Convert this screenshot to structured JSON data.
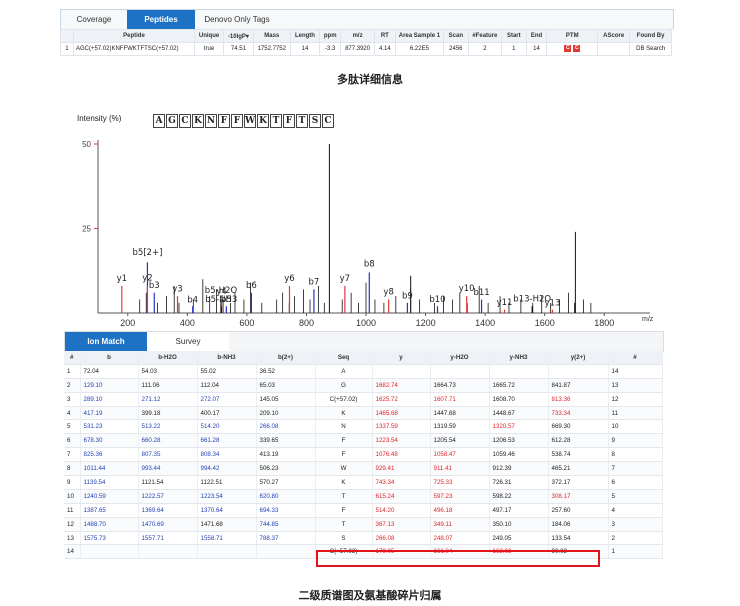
{
  "top_tabs": [
    "Coverage",
    "Peptides",
    "Denovo Only Tags"
  ],
  "peptide_table": {
    "headers": [
      "",
      "Peptide",
      "Unique",
      "-10lgP▾",
      "Mass",
      "Length",
      "ppm",
      "m/z",
      "RT",
      "Area Sample 1",
      "Scan",
      "#Feature",
      "Start",
      "End",
      "PTM",
      "AScore",
      "Found By"
    ],
    "row": [
      "1",
      "AGC(+57.02)KNFFWKTFTSC(+57.02)",
      "true",
      "74.51",
      "1752.7752",
      "14",
      "-3.3",
      "877.3920",
      "4.14",
      "6.22E5",
      "2456",
      "2",
      "1",
      "14",
      "",
      "",
      "DB Search"
    ],
    "ptm": [
      "C",
      "C"
    ]
  },
  "caption1": "多肽详细信息",
  "spectrum": {
    "y_label": "Intensity (%)",
    "x_label": "m/z",
    "sequence": [
      "A",
      "G",
      "C",
      "K",
      "N",
      "F",
      "F",
      "W",
      "K",
      "T",
      "F",
      "T",
      "S",
      "C"
    ],
    "x_ticks": [
      "200",
      "400",
      "600",
      "800",
      "1000",
      "1200",
      "1400",
      "1600",
      "1800"
    ],
    "y_ticks": [
      "50",
      "25"
    ],
    "xlim": [
      100,
      1920
    ],
    "ylim": [
      0,
      50
    ],
    "ion_labels": [
      "y1",
      "b5[2+]",
      "y2",
      "b3",
      "y3",
      "b4",
      "b5-H2O",
      "y4",
      "b5-NH3",
      "b5",
      "b6",
      "y6",
      "b7",
      "y7",
      "b8",
      "y8",
      "b9",
      "b10",
      "y10",
      "y11",
      "b11",
      "b13-H2O",
      "y13"
    ],
    "colors": {
      "b": "#2233cc",
      "y": "#e53935",
      "other": "#111111"
    }
  },
  "ion_tabs": [
    "Ion Match",
    "Survey"
  ],
  "ion_table": {
    "headers": [
      "#",
      "b",
      "b-H2O",
      "b-NH3",
      "b(2+)",
      "Seq",
      "y",
      "y-H2O",
      "y-NH3",
      "y(2+)",
      "#"
    ],
    "rows": [
      [
        "1",
        "72.04",
        "54.03",
        "55.02",
        "36.52",
        "A",
        "",
        "",
        "",
        "",
        "14"
      ],
      [
        "2",
        "129.10",
        "111.06",
        "112.04",
        "65.03",
        "G",
        "1682.74",
        "1664.73",
        "1665.72",
        "841.87",
        "13"
      ],
      [
        "3",
        "289.10",
        "271.12",
        "272.07",
        "145.05",
        "C(+57.02)",
        "1625.72",
        "1607.71",
        "1608.70",
        "813.36",
        "12"
      ],
      [
        "4",
        "417.19",
        "399.18",
        "400.17",
        "209.10",
        "K",
        "1465.68",
        "1447.68",
        "1448.67",
        "733.34",
        "11"
      ],
      [
        "5",
        "531.23",
        "513.22",
        "514.20",
        "266.08",
        "N",
        "1337.59",
        "1319.59",
        "1320.57",
        "669.30",
        "10"
      ],
      [
        "6",
        "678.30",
        "660.28",
        "661.28",
        "339.65",
        "F",
        "1223.54",
        "1205.54",
        "1206.53",
        "612.28",
        "9"
      ],
      [
        "7",
        "825.36",
        "807.35",
        "808.34",
        "413.19",
        "F",
        "1076.48",
        "1058.47",
        "1059.46",
        "538.74",
        "8"
      ],
      [
        "8",
        "1011.44",
        "993.44",
        "994.42",
        "506.23",
        "W",
        "929.41",
        "911.41",
        "912.39",
        "465.21",
        "7"
      ],
      [
        "9",
        "1139.54",
        "1121.54",
        "1122.51",
        "570.27",
        "K",
        "743.34",
        "725.33",
        "726.31",
        "372.17",
        "6"
      ],
      [
        "10",
        "1240.59",
        "1222.57",
        "1223.54",
        "620.80",
        "T",
        "615.24",
        "597.23",
        "598.22",
        "308.17",
        "5"
      ],
      [
        "11",
        "1387.65",
        "1369.64",
        "1370.64",
        "694.33",
        "F",
        "514.20",
        "496.18",
        "497.17",
        "257.60",
        "4"
      ],
      [
        "12",
        "1488.70",
        "1470.69",
        "1471.68",
        "744.85",
        "T",
        "367.13",
        "349.11",
        "350.10",
        "184.06",
        "3"
      ],
      [
        "13",
        "1575.73",
        "1557.71",
        "1558.71",
        "788.37",
        "S",
        "266.08",
        "248.07",
        "249.05",
        "133.54",
        "2"
      ],
      [
        "14",
        "",
        "",
        "",
        "",
        "C(+57.02)",
        "179.05",
        "161.04",
        "162.02",
        "90.02",
        "1"
      ]
    ]
  },
  "caption2": "二级质谱图及氨基酸碎片归属"
}
